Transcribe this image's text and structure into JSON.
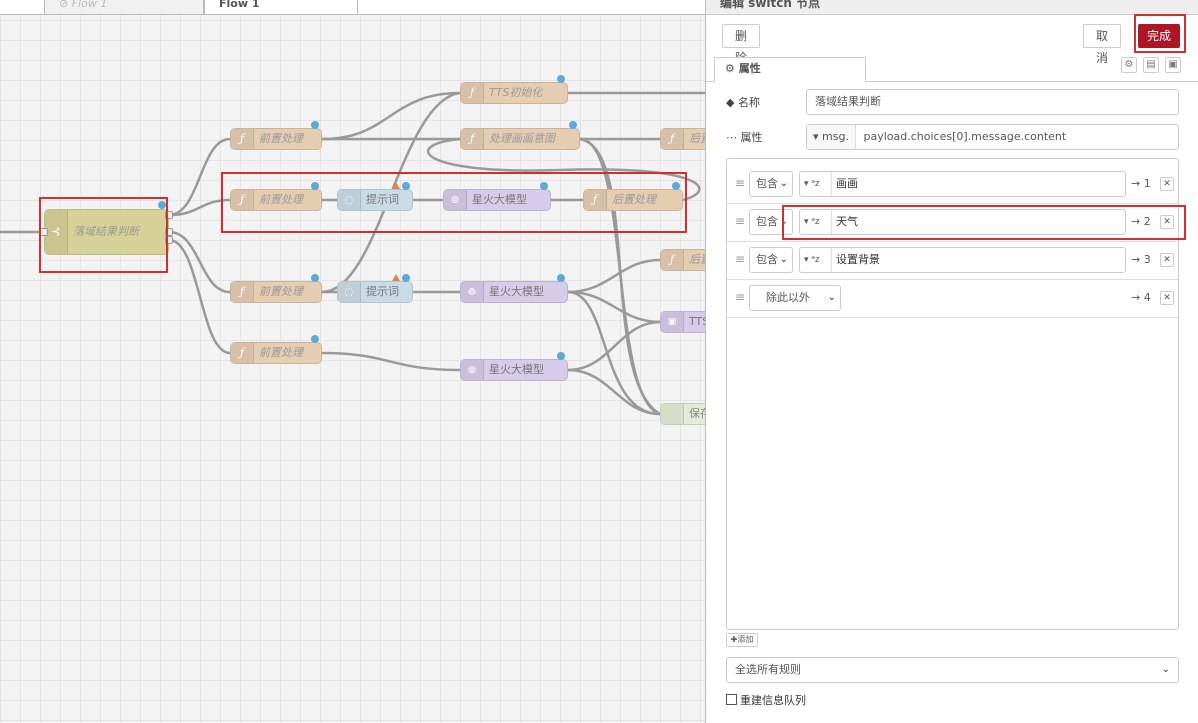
{
  "workspace": {
    "tabs": [
      {
        "label": "⊘ Flow 1"
      },
      {
        "label": "Flow 1"
      }
    ],
    "nodes": {
      "tts_init": "TTS初始化",
      "pre1": "前置处理",
      "draw_intent": "处理画画意图",
      "post_top": "后置",
      "pre2": "前置处理",
      "prompt1": "提示词",
      "spark1": "星火大模型",
      "post_mid": "后置处理",
      "switch": "落域结果判断",
      "post_right": "后置",
      "pre3": "前置处理",
      "prompt2": "提示词",
      "spark2": "星火大模型",
      "tts_right": "TTS",
      "pre4": "前置处理",
      "spark3": "星火大模型",
      "save_right": "保存"
    }
  },
  "editor": {
    "title": "编辑 switch 节点",
    "delete_label": "删除",
    "cancel_label": "取消",
    "done_label": "完成",
    "tab_label": "属性",
    "name_label": "名称",
    "name_value": "落域结果判断",
    "property_label": "属性",
    "property_prefix": "msg.",
    "property_value": "payload.choices[0].message.content",
    "rules": [
      {
        "op": "包含",
        "type": "a z",
        "value": "画画",
        "out": "→ 1"
      },
      {
        "op": "包含",
        "type": "a z",
        "value": "天气",
        "out": "→ 2"
      },
      {
        "op": "包含",
        "type": "a z",
        "value": "设置背景",
        "out": "→ 3"
      },
      {
        "op": "除此以外",
        "type": "",
        "value": "",
        "out": "→ 4"
      }
    ],
    "add_label": "添加",
    "check_mode": "全选所有规则",
    "rebuild_label": "重建信息队列"
  },
  "colors": {
    "accent": "#ad1625",
    "highlight": "#d32f2f",
    "function_node": "#e5cdb2",
    "switch_node": "#d7d197",
    "ai_node": "#d6cbe8",
    "template_node": "#c9dbe4",
    "status_dot": "#5ea9d6"
  }
}
